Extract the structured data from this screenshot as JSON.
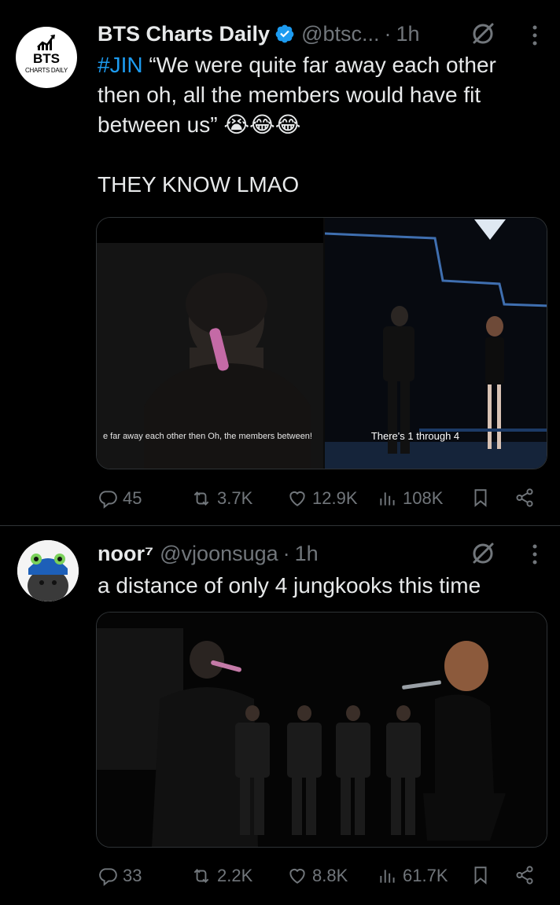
{
  "tweets": [
    {
      "name": "BTS Charts Daily",
      "handle": "@btsc...",
      "separator": "·",
      "time": "1h",
      "avatar_text": "BTS",
      "avatar_subtext": "CHARTS DAILY",
      "text_hashtag": "#JIN",
      "text_body": " “We were quite far away each other then oh, all the members would have fit between us” 😭😂😂\n\nTHEY KNOW LMAO",
      "media_left_caption": "e far away each other then Oh, the members between!",
      "media_right_caption": "There's 1 through 4",
      "stats": {
        "replies": "45",
        "retweets": "3.7K",
        "likes": "12.9K",
        "views": "108K"
      }
    },
    {
      "name": "noor⁷",
      "handle": "@vjoonsuga",
      "separator": "·",
      "time": "1h",
      "text_body": "a distance of only 4 jungkooks this time",
      "stats": {
        "replies": "33",
        "retweets": "2.2K",
        "likes": "8.8K",
        "views": "61.7K"
      }
    }
  ],
  "colors": {
    "link": "#1d9bf0",
    "muted": "#71767b",
    "text": "#e7e9ea",
    "verified": "#1d9bf0"
  },
  "icons": [
    "verified-badge-icon",
    "grok-icon",
    "more-icon",
    "reply-icon",
    "retweet-icon",
    "like-icon",
    "views-icon",
    "bookmark-icon",
    "share-icon"
  ]
}
